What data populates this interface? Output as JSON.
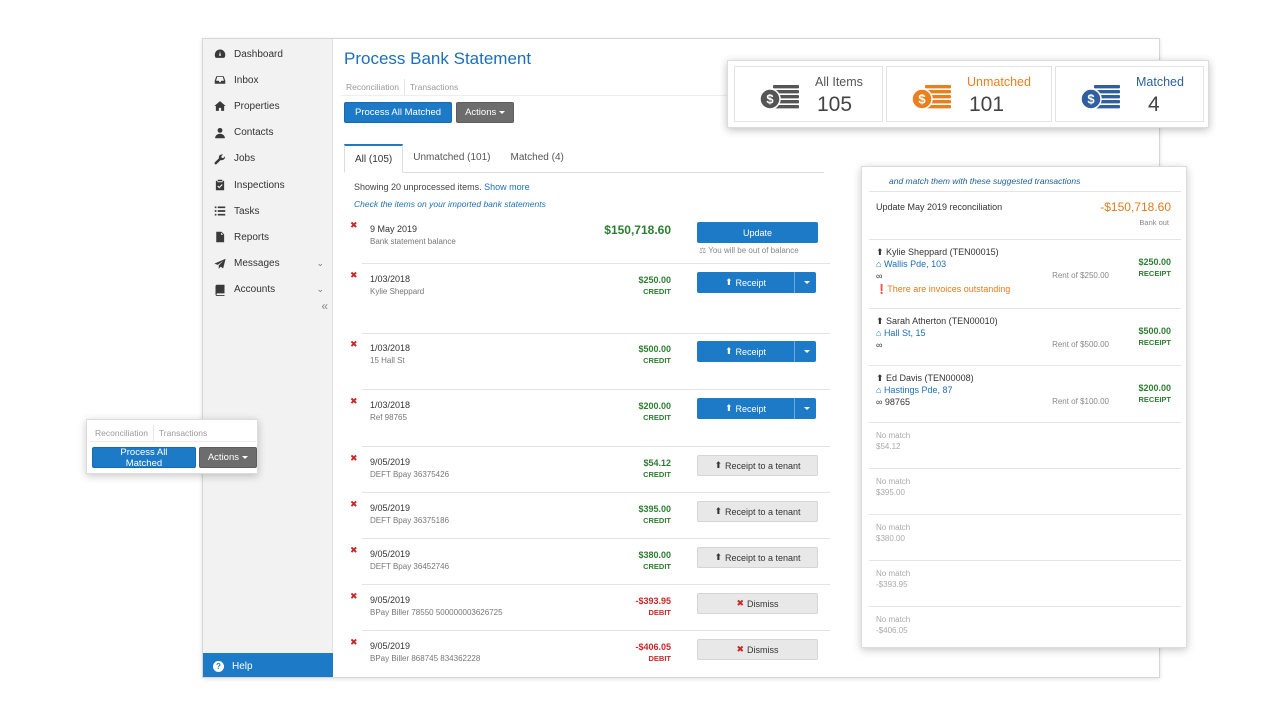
{
  "sidebar": {
    "items": [
      {
        "label": "Dashboard",
        "icon": "dashboard-icon"
      },
      {
        "label": "Inbox",
        "icon": "inbox-icon"
      },
      {
        "label": "Properties",
        "icon": "home-icon"
      },
      {
        "label": "Contacts",
        "icon": "user-icon"
      },
      {
        "label": "Jobs",
        "icon": "wrench-icon"
      },
      {
        "label": "Inspections",
        "icon": "clipboard-check-icon"
      },
      {
        "label": "Tasks",
        "icon": "list-icon"
      },
      {
        "label": "Reports",
        "icon": "document-icon"
      },
      {
        "label": "Messages",
        "icon": "paper-plane-icon"
      },
      {
        "label": "Accounts",
        "icon": "book-icon"
      }
    ],
    "collapse_glyph": "«",
    "help_label": "Help"
  },
  "page": {
    "title": "Process Bank Statement",
    "subtabs": [
      "Reconciliation",
      "Transactions"
    ],
    "process_all_label": "Process All Matched",
    "actions_label": "Actions"
  },
  "tabs": [
    {
      "label": "All (105)",
      "active": true
    },
    {
      "label": "Unmatched (101)",
      "active": false
    },
    {
      "label": "Matched (4)",
      "active": false
    }
  ],
  "list": {
    "showing": "Showing 20 unprocessed items.",
    "show_more": "Show more",
    "hint": "Check the items on your imported bank statements",
    "balance": {
      "date": "9 May 2019",
      "desc": "Bank statement balance",
      "amount": "$150,718.60",
      "button": "Update",
      "note": "You will be out of balance"
    },
    "rows": [
      {
        "date": "1/03/2018",
        "desc": "Kylie Sheppard",
        "amount": "$250.00",
        "kind": "CREDIT",
        "action": "Receipt"
      },
      {
        "date": "1/03/2018",
        "desc": "15 Hall St",
        "amount": "$500.00",
        "kind": "CREDIT",
        "action": "Receipt"
      },
      {
        "date": "1/03/2018",
        "desc": "Ref 98765",
        "amount": "$200.00",
        "kind": "CREDIT",
        "action": "Receipt"
      },
      {
        "date": "9/05/2019",
        "desc": "DEFT Bpay 36375426",
        "amount": "$54.12",
        "kind": "CREDIT",
        "action": "Receipt to a tenant"
      },
      {
        "date": "9/05/2019",
        "desc": "DEFT Bpay 36375186",
        "amount": "$395.00",
        "kind": "CREDIT",
        "action": "Receipt to a tenant"
      },
      {
        "date": "9/05/2019",
        "desc": "DEFT Bpay 36452746",
        "amount": "$380.00",
        "kind": "CREDIT",
        "action": "Receipt to a tenant"
      },
      {
        "date": "9/05/2019",
        "desc": "BPay Biller 78550 500000003626725",
        "amount": "-$393.95",
        "kind": "DEBIT",
        "action": "Dismiss"
      },
      {
        "date": "9/05/2019",
        "desc": "BPay Biller 868745 834362228",
        "amount": "-$406.05",
        "kind": "DEBIT",
        "action": "Dismiss"
      }
    ]
  },
  "stats": [
    {
      "label": "All Items",
      "value": "105",
      "color": "#555555"
    },
    {
      "label": "Unmatched",
      "value": "101",
      "color": "#e8801f"
    },
    {
      "label": "Matched",
      "value": "4",
      "color": "#2f5f9e"
    }
  ],
  "suggest": {
    "header": "and match them with these suggested transactions",
    "update": {
      "title": "Update May 2019 reconciliation",
      "amount": "-$150,718.60",
      "sub": "Bank out"
    },
    "matches": [
      {
        "name": "Kylie Sheppard (TEN00015)",
        "address": "Wallis Pde, 103",
        "ref": "",
        "rent": "Rent of $250.00",
        "amount": "$250.00",
        "kind": "RECEIPT",
        "warning": "There are invoices outstanding"
      },
      {
        "name": "Sarah Atherton (TEN00010)",
        "address": "Hall St, 15",
        "ref": "",
        "rent": "Rent of $500.00",
        "amount": "$500.00",
        "kind": "RECEIPT",
        "warning": ""
      },
      {
        "name": "Ed Davis (TEN00008)",
        "address": "Hastings Pde, 87",
        "ref": "98765",
        "rent": "Rent of $100.00",
        "amount": "$200.00",
        "kind": "RECEIPT",
        "warning": ""
      }
    ],
    "no_match_label": "No match",
    "no_match_amounts": [
      "$54.12",
      "$395.00",
      "$380.00",
      "-$393.95",
      "-$406.05"
    ]
  },
  "float_panel": {
    "subtabs": [
      "Reconciliation",
      "Transactions"
    ],
    "process_all_label": "Process All Matched",
    "actions_label": "Actions"
  }
}
